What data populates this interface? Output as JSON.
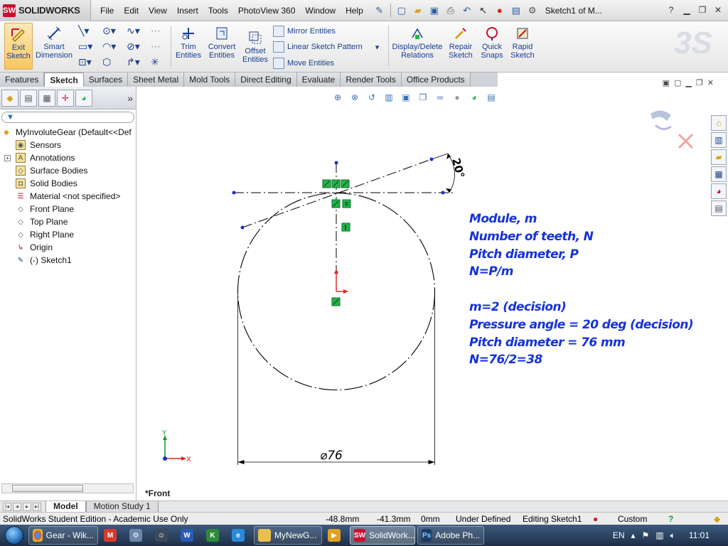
{
  "app": {
    "logo": "SOLIDWORKS",
    "window_title": "Sketch1 of M...",
    "menu": [
      "File",
      "Edit",
      "View",
      "Insert",
      "Tools",
      "PhotoView 360",
      "Window",
      "Help"
    ]
  },
  "command_manager": {
    "exit_sketch": "Exit Sketch",
    "smart_dimension": "Smart Dimension",
    "trim_entities": "Trim Entities",
    "convert_entities": "Convert Entities",
    "offset_entities": "Offset Entities",
    "mirror_entities": "Mirror Entities",
    "linear_sketch_pattern": "Linear Sketch Pattern",
    "move_entities": "Move Entities",
    "display_delete_relations": "Display/Delete Relations",
    "repair_sketch": "Repair Sketch",
    "quick_snaps": "Quick Snaps",
    "rapid_sketch": "Rapid Sketch"
  },
  "tabs": [
    "Features",
    "Sketch",
    "Surfaces",
    "Sheet Metal",
    "Mold Tools",
    "Direct Editing",
    "Evaluate",
    "Render Tools",
    "Office Products"
  ],
  "active_tab": "Sketch",
  "feature_tree": {
    "root": "MyInvoluteGear  (Default<<Def",
    "items": [
      {
        "label": "Sensors",
        "icon": "sensors-icon"
      },
      {
        "label": "Annotations",
        "icon": "annotations-icon"
      },
      {
        "label": "Surface Bodies",
        "icon": "surface-bodies-icon"
      },
      {
        "label": "Solid Bodies",
        "icon": "solid-bodies-icon"
      },
      {
        "label": "Material <not specified>",
        "icon": "material-icon"
      },
      {
        "label": "Front Plane",
        "icon": "plane-icon"
      },
      {
        "label": "Top Plane",
        "icon": "plane-icon"
      },
      {
        "label": "Right Plane",
        "icon": "plane-icon"
      },
      {
        "label": "Origin",
        "icon": "origin-icon"
      },
      {
        "label": "(-) Sketch1",
        "icon": "sketch-icon"
      }
    ]
  },
  "graphics": {
    "view_label": "*Front",
    "diameter_dimension": "⌀76",
    "angle_dimension": "20°",
    "triad": {
      "y": "Y",
      "x": "X"
    },
    "notes": [
      "Module, m",
      "Number of teeth, N",
      "Pitch diameter, P",
      "N=P/m",
      "",
      "m=2 (decision)",
      "Pressure angle = 20 deg (decision)",
      "Pitch diameter = 76 mm",
      "N=76/2=38"
    ]
  },
  "model_tabs": [
    "Model",
    "Motion Study 1"
  ],
  "status_bar": {
    "edition": "SolidWorks Student Edition - Academic Use Only",
    "x": "-48.8mm",
    "y": "-41.3mm",
    "z": "0mm",
    "state": "Under Defined",
    "editing": "Editing Sketch1",
    "units": "Custom"
  },
  "taskbar": {
    "items": [
      "Gear - Wik...",
      "MyNewG...",
      "SolidWork...",
      "Adobe Ph..."
    ],
    "active": "SolidWork...",
    "language": "EN",
    "time": "11:01"
  },
  "colors": {
    "note_text": "#1632d8",
    "sketch_point": "#1a2fd0",
    "relation_green": "#22b54a",
    "axis_red": "#e02020",
    "axis_green": "#1a9a3a"
  }
}
